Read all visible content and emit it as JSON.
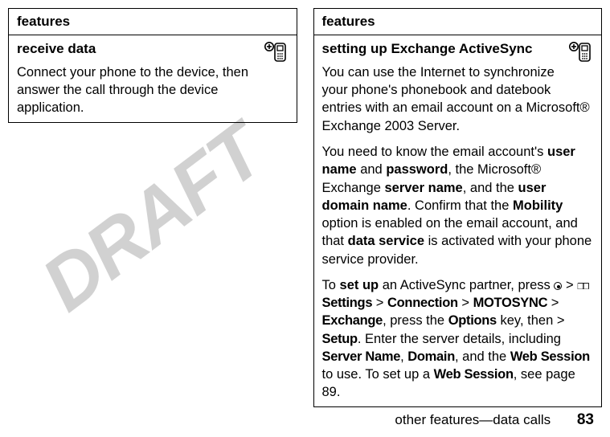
{
  "watermark": "DRAFT",
  "left": {
    "header": "features",
    "row_title": "receive data",
    "row_body": "Connect your phone to the device, then answer the call through the device application."
  },
  "right": {
    "header": "features",
    "row_title": "setting up Exchange ActiveSync",
    "p1_a": "You can use the Internet to synchronize your phone's phonebook and datebook entries with an email account on a Microsoft® Exchange 2003 Server.",
    "p2_a": "You need to know the email account's ",
    "p2_b": "user name",
    "p2_c": " and ",
    "p2_d": "password",
    "p2_e": ", the Microsoft® Exchange ",
    "p2_f": "server name",
    "p2_g": ", and the ",
    "p2_h": "user domain name",
    "p2_i": ". Confirm that the ",
    "p2_j": "Mobility",
    "p2_k": " option is enabled on the email account, and that ",
    "p2_l": "data service",
    "p2_m": " is activated with your phone service provider.",
    "p3_a": "To ",
    "p3_b": "set up",
    "p3_c": " an ActiveSync partner, press ",
    "p3_d": " > ",
    "p3_e": "Settings",
    "p3_f": " > ",
    "p3_g": "Connection",
    "p3_h": " > ",
    "p3_i": "MOTOSYNC",
    "p3_j": " > ",
    "p3_k": "Exchange",
    "p3_l": ", press the ",
    "p3_m": "Options",
    "p3_n": " key, then > ",
    "p3_o": "Setup",
    "p3_p": ". Enter the server details, including ",
    "p3_q": "Server Name",
    "p3_r": ", ",
    "p3_s": "Domain",
    "p3_t": ", and the ",
    "p3_u": "Web Session",
    "p3_v": " to use. To set up a ",
    "p3_w": "Web Session",
    "p3_x": ", see page 89."
  },
  "footer": {
    "section": "other features—data calls",
    "page": "83"
  }
}
